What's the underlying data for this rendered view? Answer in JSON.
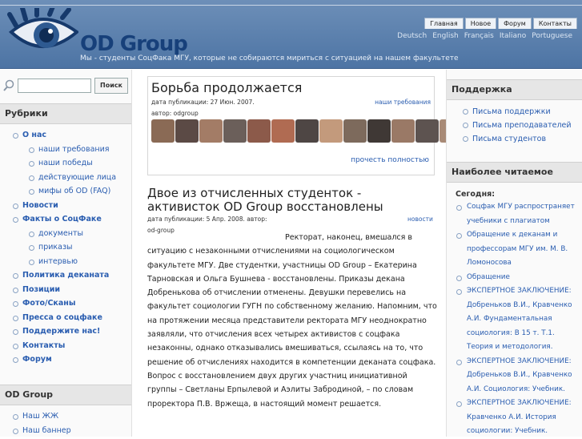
{
  "header": {
    "site_name": "OD Group",
    "tagline": "Мы - студенты СоцФака МГУ, которые не собираются мириться с ситуацией на нашем факультете",
    "nav": [
      "Главная",
      "Новое",
      "Форум",
      "Контакты"
    ],
    "languages": [
      "Deutsch",
      "English",
      "Français",
      "Italiano",
      "Portuguese"
    ]
  },
  "search": {
    "placeholder": "",
    "value": "",
    "button": "Поиск"
  },
  "left": {
    "rubrics_title": "Рубрики",
    "rubrics": [
      {
        "label": "О нас",
        "level": 1
      },
      {
        "label": "наши требования",
        "level": 2
      },
      {
        "label": "наши победы",
        "level": 2
      },
      {
        "label": "действующие лица",
        "level": 2
      },
      {
        "label": "мифы об OD (FAQ)",
        "level": 2
      },
      {
        "label": "Новости",
        "level": 1
      },
      {
        "label": "Факты о СоцФаке",
        "level": 1
      },
      {
        "label": "документы",
        "level": 2
      },
      {
        "label": "приказы",
        "level": 2
      },
      {
        "label": "интервью",
        "level": 2
      },
      {
        "label": "Политика деканата",
        "level": 1
      },
      {
        "label": "Позиции",
        "level": 1
      },
      {
        "label": "Фото/Сканы",
        "level": 1
      },
      {
        "label": "Пресса о соцфаке",
        "level": 1
      },
      {
        "label": "Поддержите нас!",
        "level": 1
      },
      {
        "label": "Контакты",
        "level": 1
      },
      {
        "label": "Форум",
        "level": 1
      }
    ],
    "group_title": "OD Group",
    "group_links": [
      "Наш ЖЖ",
      "Наш баннер"
    ]
  },
  "feature": {
    "title": "Борьба продолжается",
    "date": "дата публикации: 27 Июн. 2007.",
    "category": "наши требования",
    "author": "автор: odgroup",
    "read_more": "прочесть полностью"
  },
  "article": {
    "title": "Двое из отчисленных студенток - активисток OD Group восстановлены",
    "date": "дата публикации: 5 Апр. 2008. автор:",
    "category": "новости",
    "author": "od-group",
    "body": "Ректорат, наконец, вмешался в ситуацию с незаконными отчислениями на социологическом факультете МГУ. Две студентки, участницы OD Group – Екатерина Тарновская и Ольга Бушнева - восстановлены. Приказы декана Добренькова об отчислении отменены. Девушки перевелись на факультет социологии ГУГН по собственному желанию. Напомним, что на протяжении месяца представители ректората МГУ неоднократно заявляли, что отчисления всех четырех активистов с соцфака незаконны, однако отказывались вмешиваться, ссылаясь на то, что решение об отчислениях находится в компетенции деканата соцфака. Вопрос с восстановлением двух других участниц инициативной группы – Светланы Ерпылевой и Аэлиты Забродиной, – по словам проректора П.В. Вржеща, в настоящий момент решается."
  },
  "right": {
    "support_title": "Поддержка",
    "support_links": [
      "Письма поддержки",
      "Письма преподавателей",
      "Письма студентов"
    ],
    "popular_title": "Наиболее читаемое",
    "popular_today": "Сегодня:",
    "popular_links": [
      "Соцфак МГУ распространяет учебники с плагиатом",
      "Обращение к деканам и профессорам МГУ им. М. В. Ломоносова",
      "Обращение",
      "ЭКСПЕРТНОЕ ЗАКЛЮЧЕНИЕ: Добреньков В.И., Кравченко А.И. Фундаментальная социология: В 15 т. Т.1. Теория и методология.",
      "ЭКСПЕРТНОЕ ЗАКЛЮЧЕНИЕ: Добреньков В.И., Кравченко А.И. Социология: Учебник.",
      "ЭКСПЕРТНОЕ ЗАКЛЮЧЕНИЕ: Кравченко А.И. История социологии: Учебник."
    ]
  },
  "colors": {
    "header_blue": "#5a7fae",
    "link": "#2a5db0",
    "logo_text": "#17407a"
  }
}
